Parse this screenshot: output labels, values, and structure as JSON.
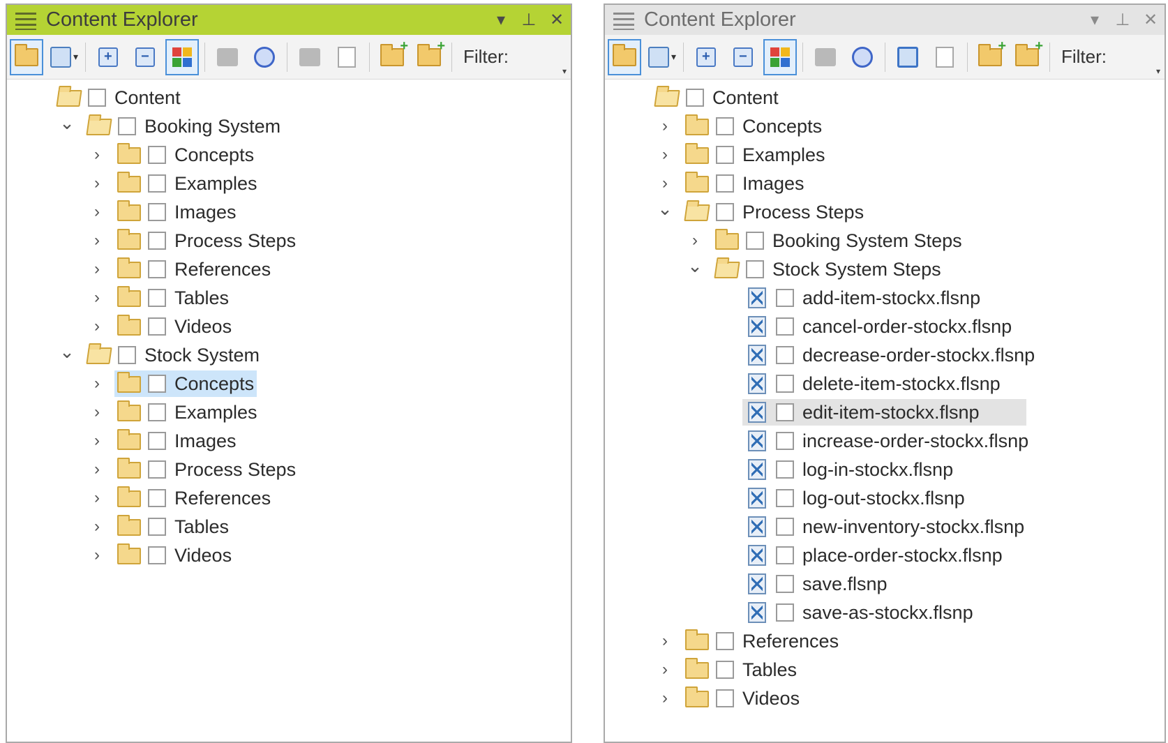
{
  "left_panel": {
    "title": "Content Explorer",
    "filter_label": "Filter:",
    "tree": [
      {
        "label": "Content",
        "level": 0,
        "expander": "none",
        "icon": "folder-open-icon"
      },
      {
        "label": "Booking System",
        "level": 1,
        "expander": "expanded",
        "icon": "folder-open-icon"
      },
      {
        "label": "Concepts",
        "level": 2,
        "expander": "collapsed",
        "icon": "folder-icon"
      },
      {
        "label": "Examples",
        "level": 2,
        "expander": "collapsed",
        "icon": "folder-icon"
      },
      {
        "label": "Images",
        "level": 2,
        "expander": "collapsed",
        "icon": "folder-icon"
      },
      {
        "label": "Process Steps",
        "level": 2,
        "expander": "collapsed",
        "icon": "folder-icon"
      },
      {
        "label": "References",
        "level": 2,
        "expander": "collapsed",
        "icon": "folder-icon"
      },
      {
        "label": "Tables",
        "level": 2,
        "expander": "collapsed",
        "icon": "folder-icon"
      },
      {
        "label": "Videos",
        "level": 2,
        "expander": "collapsed",
        "icon": "folder-icon"
      },
      {
        "label": "Stock System",
        "level": 1,
        "expander": "expanded",
        "icon": "folder-open-icon"
      },
      {
        "label": "Concepts",
        "level": 2,
        "expander": "collapsed",
        "icon": "folder-icon",
        "selected": true
      },
      {
        "label": "Examples",
        "level": 2,
        "expander": "collapsed",
        "icon": "folder-icon"
      },
      {
        "label": "Images",
        "level": 2,
        "expander": "collapsed",
        "icon": "folder-icon"
      },
      {
        "label": "Process Steps",
        "level": 2,
        "expander": "collapsed",
        "icon": "folder-icon"
      },
      {
        "label": "References",
        "level": 2,
        "expander": "collapsed",
        "icon": "folder-icon"
      },
      {
        "label": "Tables",
        "level": 2,
        "expander": "collapsed",
        "icon": "folder-icon"
      },
      {
        "label": "Videos",
        "level": 2,
        "expander": "collapsed",
        "icon": "folder-icon"
      }
    ]
  },
  "right_panel": {
    "title": "Content Explorer",
    "filter_label": "Filter:",
    "tree": [
      {
        "label": "Content",
        "level": 0,
        "expander": "none",
        "icon": "folder-open-icon"
      },
      {
        "label": "Concepts",
        "level": 1,
        "expander": "collapsed",
        "icon": "folder-icon"
      },
      {
        "label": "Examples",
        "level": 1,
        "expander": "collapsed",
        "icon": "folder-icon"
      },
      {
        "label": "Images",
        "level": 1,
        "expander": "collapsed",
        "icon": "folder-icon"
      },
      {
        "label": "Process Steps",
        "level": 1,
        "expander": "expanded",
        "icon": "folder-open-icon"
      },
      {
        "label": "Booking System Steps",
        "level": 2,
        "expander": "collapsed",
        "icon": "folder-icon"
      },
      {
        "label": "Stock System Steps",
        "level": 2,
        "expander": "expanded",
        "icon": "folder-open-icon"
      },
      {
        "label": "add-item-stockx.flsnp",
        "level": 3,
        "expander": "none",
        "icon": "snippet-file-icon"
      },
      {
        "label": "cancel-order-stockx.flsnp",
        "level": 3,
        "expander": "none",
        "icon": "snippet-file-icon"
      },
      {
        "label": "decrease-order-stockx.flsnp",
        "level": 3,
        "expander": "none",
        "icon": "snippet-file-icon"
      },
      {
        "label": "delete-item-stockx.flsnp",
        "level": 3,
        "expander": "none",
        "icon": "snippet-file-icon"
      },
      {
        "label": "edit-item-stockx.flsnp",
        "level": 3,
        "expander": "none",
        "icon": "snippet-file-icon",
        "selected_inactive": true
      },
      {
        "label": "increase-order-stockx.flsnp",
        "level": 3,
        "expander": "none",
        "icon": "snippet-file-icon"
      },
      {
        "label": "log-in-stockx.flsnp",
        "level": 3,
        "expander": "none",
        "icon": "snippet-file-icon"
      },
      {
        "label": "log-out-stockx.flsnp",
        "level": 3,
        "expander": "none",
        "icon": "snippet-file-icon"
      },
      {
        "label": "new-inventory-stockx.flsnp",
        "level": 3,
        "expander": "none",
        "icon": "snippet-file-icon"
      },
      {
        "label": "place-order-stockx.flsnp",
        "level": 3,
        "expander": "none",
        "icon": "snippet-file-icon"
      },
      {
        "label": "save.flsnp",
        "level": 3,
        "expander": "none",
        "icon": "snippet-file-icon"
      },
      {
        "label": "save-as-stockx.flsnp",
        "level": 3,
        "expander": "none",
        "icon": "snippet-file-icon"
      },
      {
        "label": "References",
        "level": 1,
        "expander": "collapsed",
        "icon": "folder-icon"
      },
      {
        "label": "Tables",
        "level": 1,
        "expander": "collapsed",
        "icon": "folder-icon"
      },
      {
        "label": "Videos",
        "level": 1,
        "expander": "collapsed",
        "icon": "folder-icon"
      }
    ]
  },
  "colors": {
    "active_title_bar": "#b5d334",
    "inactive_title_bar": "#e4e4e4",
    "selection_active": "#cde5fa",
    "selection_inactive": "#e3e3e3",
    "folder": "#f5d88c"
  },
  "glyphs": {
    "expanded": "⌄",
    "collapsed": "›",
    "dropdown": "▾",
    "pin": "⊥",
    "close": "✕"
  }
}
